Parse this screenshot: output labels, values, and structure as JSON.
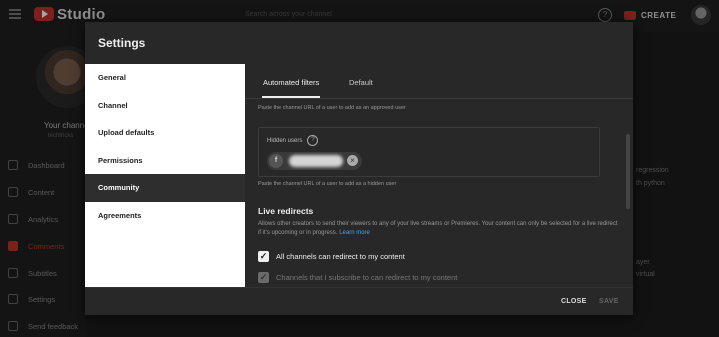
{
  "app": {
    "title": "Studio",
    "search_placeholder": "Search across your channel",
    "create_label": "CREATE"
  },
  "sidebar": {
    "channel_name": "Your channel",
    "channel_handle": "techtricks",
    "items": [
      {
        "label": "Dashboard",
        "icon": "dashboard-icon"
      },
      {
        "label": "Content",
        "icon": "content-icon"
      },
      {
        "label": "Analytics",
        "icon": "analytics-icon"
      },
      {
        "label": "Comments",
        "icon": "comments-icon",
        "active": true
      },
      {
        "label": "Subtitles",
        "icon": "subtitles-icon"
      },
      {
        "label": "Settings",
        "icon": "settings-icon"
      },
      {
        "label": "Send feedback",
        "icon": "feedback-icon"
      }
    ]
  },
  "background_text": [
    "regression",
    "th python",
    "ayer",
    "virtual"
  ],
  "modal": {
    "title": "Settings",
    "nav": [
      "General",
      "Channel",
      "Upload defaults",
      "Permissions",
      "Community",
      "Agreements"
    ],
    "active_nav": "Community",
    "tabs": [
      "Automated filters",
      "Default"
    ],
    "approved_help": "Paste the channel URL of a user to add as an approved user",
    "hidden_users_label": "Hidden users",
    "hidden_user_initial": "f",
    "hidden_help": "Paste the channel URL of a user to add as a hidden user",
    "live_redirects": {
      "title": "Live redirects",
      "description": "Allows other creators to send their viewers to any of your live streams or Premieres. Your content can only be selected for a live redirect if it's upcoming or in progress.",
      "learn_more": "Learn more",
      "option_all": "All channels can redirect to my content",
      "option_subscribed": "Channels that I subscribe to can redirect to my content"
    },
    "footer": {
      "close": "CLOSE",
      "save": "SAVE"
    }
  },
  "colors": {
    "accent_red": "#c4302b",
    "link_blue": "#3ea6ff",
    "modal_bg": "#282828"
  }
}
